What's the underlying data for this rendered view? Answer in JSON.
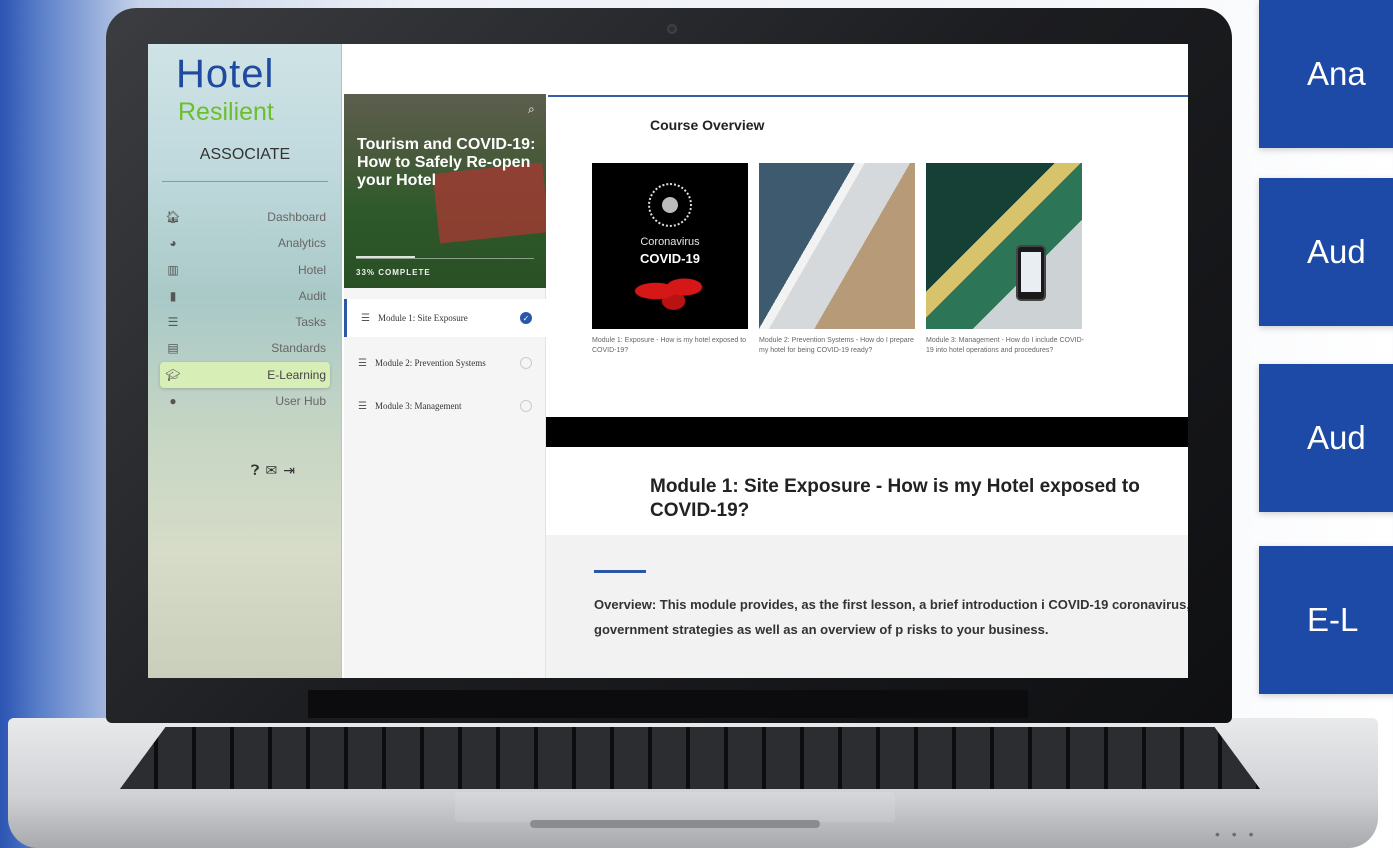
{
  "cards": [
    "Ana",
    "Aud",
    "Aud",
    "E-L"
  ],
  "sidebar": {
    "logo_hotel": "Hotel",
    "logo_resilient": "Resilient",
    "logo_associate": "ASSOCIATE",
    "items": [
      {
        "label": "Dashboard",
        "icon": "home-icon"
      },
      {
        "label": "Analytics",
        "icon": "pie-chart-icon"
      },
      {
        "label": "Hotel",
        "icon": "building-icon"
      },
      {
        "label": "Audit",
        "icon": "clipboard-icon"
      },
      {
        "label": "Tasks",
        "icon": "tasks-icon"
      },
      {
        "label": "Standards",
        "icon": "book-icon"
      },
      {
        "label": "E-Learning",
        "icon": "graduation-cap-icon"
      },
      {
        "label": "User Hub",
        "icon": "user-icon"
      }
    ],
    "active_item": "E-Learning"
  },
  "course": {
    "title": "Tourism and COVID-19: How to Safely Re-open your Hotel",
    "progress_label": "33% COMPLETE",
    "progress": 0.33,
    "modules": [
      {
        "label": "Module 1: Site Exposure",
        "completed": true
      },
      {
        "label": "Module 2: Prevention Systems",
        "completed": false
      },
      {
        "label": "Module 3: Management",
        "completed": false
      }
    ]
  },
  "main": {
    "overview_title": "Course Overview",
    "thumb1_word": "Coronavirus",
    "thumb1_big": "COVID-19",
    "captions": [
      "Module 1: Exposure - How is my hotel exposed to COVID-19?",
      "Module 2: Prevention Systems - How do I prepare my hotel for being COVID-19 ready?",
      "Module 3: Management - How do I include COVID-19 into hotel operations and procedures?"
    ],
    "module_title": "Module 1: Site Exposure - How is my Hotel exposed to COVID-19?",
    "overview_text": "Overview: This module provides, as the first lesson, a brief introduction i COVID-19 coronavirus, government strategies as well as an overview of p risks to your business."
  },
  "colors": {
    "brand_blue": "#1f4aa0",
    "brand_green": "#6bbf2c",
    "card_blue": "#1c4aa6",
    "active_nav": "#d7efb6",
    "accent": "#2a57a8"
  }
}
